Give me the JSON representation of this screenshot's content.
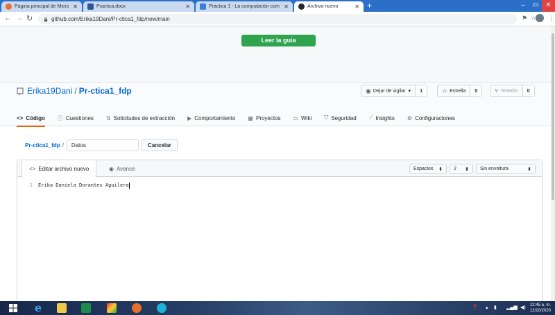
{
  "browser": {
    "tabs": [
      {
        "title": "Página principal de Microsoft Of",
        "favicon_color": "#e8702a"
      },
      {
        "title": "Practica.docx",
        "favicon_color": "#2b579a"
      },
      {
        "title": "Práctica 1 - La computación com",
        "favicon_color": "#3b7de0"
      },
      {
        "title": "Archivo nuevo",
        "favicon_color": "#24292e"
      }
    ],
    "url": "github.com/Erika19Dani/Pr-ctica1_fdp/new/main"
  },
  "banner": {
    "guide_button": "Leer la guía"
  },
  "repo": {
    "owner": "Erika19Dani",
    "separator": "/",
    "name": "Pr-ctica1_fdp",
    "watch": {
      "label": "Dejar de vigilar",
      "count": "1"
    },
    "star": {
      "label": "Estrella",
      "count": "0"
    },
    "fork": {
      "label": "Tenedor",
      "count": "0"
    },
    "nav": [
      {
        "icon": "<>",
        "label": "Código"
      },
      {
        "icon": "ⓘ",
        "label": "Cuestiones"
      },
      {
        "icon": "⇅",
        "label": "Solicitudes de extracción"
      },
      {
        "icon": "▶",
        "label": "Comportamiento"
      },
      {
        "icon": "▦",
        "label": "Proyectos"
      },
      {
        "icon": "▭",
        "label": "Wiki"
      },
      {
        "icon": "⛉",
        "label": "Seguridad"
      },
      {
        "icon": "⟋",
        "label": "Insights"
      },
      {
        "icon": "⚙",
        "label": "Configuraciones"
      }
    ]
  },
  "file": {
    "crumb": "Pr-ctica1_fdp",
    "crumb_sep": "/",
    "name_value": "Datos",
    "cancel": "Cancelar"
  },
  "editor": {
    "tab_edit": "Editar archivo nuevo",
    "tab_preview": "Avance",
    "indent_mode": "Espacios",
    "indent_size": "2",
    "wrap_mode": "Sin envoltura",
    "lines": [
      {
        "no": "1",
        "text": "Erika Daniela Dorantes Aguilera"
      }
    ]
  },
  "taskbar": {
    "time": "12:45 a. m.",
    "date": "12/10/2020"
  }
}
